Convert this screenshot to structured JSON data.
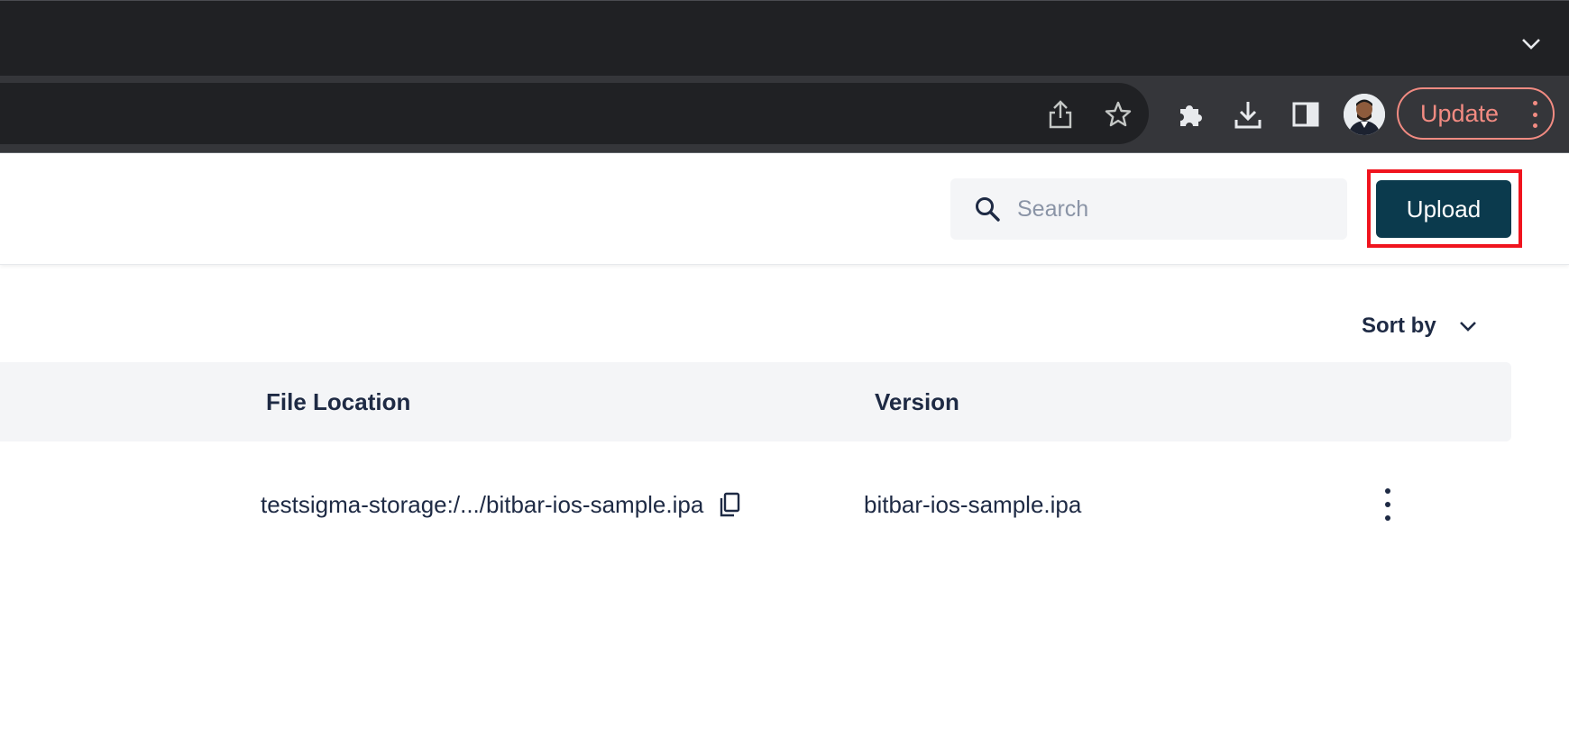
{
  "browser": {
    "toolbar": {
      "update_label": "Update",
      "icons": [
        "share-icon",
        "bookmark-star-icon",
        "extensions-icon",
        "download-icon",
        "side-panel-icon",
        "profile-avatar",
        "menu-kebab-icon"
      ]
    },
    "tab_strip": {
      "overflow_icon": "chevron-down-icon"
    }
  },
  "header": {
    "search": {
      "placeholder": "Search",
      "value": ""
    },
    "upload_label": "Upload"
  },
  "list": {
    "sort_label": "Sort by",
    "columns": {
      "file_location": "File Location",
      "version": "Version"
    },
    "rows": [
      {
        "file_location": "testsigma-storage:/.../bitbar-ios-sample.ipa",
        "version": "bitbar-ios-sample.ipa"
      }
    ]
  },
  "colors": {
    "chrome_dark": "#202124",
    "toolbar": "#35363a",
    "update_accent": "#f28b82",
    "primary_button": "#0b3a4d",
    "highlight": "#f0141e",
    "text": "#1e2a44",
    "table_header_bg": "#f4f5f7"
  }
}
